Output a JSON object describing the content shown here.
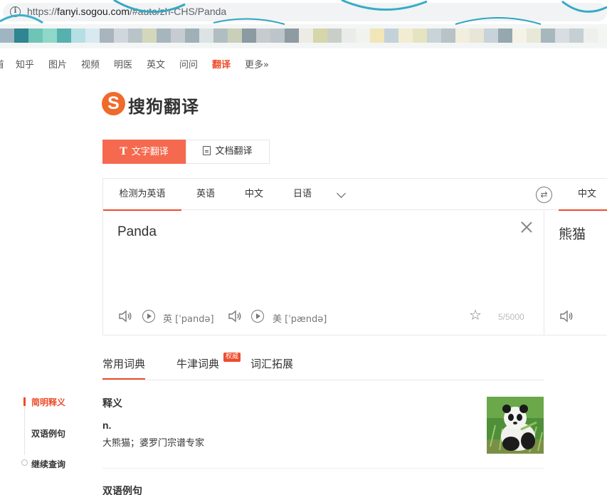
{
  "browser": {
    "url_scheme": "https://",
    "url_host": "fanyi.sogou.com",
    "url_path": "/#auto/zh-CHS/Panda"
  },
  "topnav": {
    "items": [
      {
        "label": "首",
        "active": false
      },
      {
        "label": "知乎",
        "active": false
      },
      {
        "label": "图片",
        "active": false
      },
      {
        "label": "视频",
        "active": false
      },
      {
        "label": "明医",
        "active": false
      },
      {
        "label": "英文",
        "active": false
      },
      {
        "label": "问问",
        "active": false
      },
      {
        "label": "翻译",
        "active": true
      },
      {
        "label": "更多»",
        "active": false
      }
    ]
  },
  "logo": {
    "text": "搜狗翻译",
    "mark": "S"
  },
  "modes": {
    "text_label": "文字翻译",
    "text_icon": "T",
    "doc_label": "文档翻译"
  },
  "translator": {
    "source_langs": [
      "检测为英语",
      "英语",
      "中文",
      "日语"
    ],
    "target_lang": "中文",
    "source_text": "Panda",
    "target_text": "熊猫",
    "uk_label": "英 [ˈpandə]",
    "us_label": "美 [ˈpændə]",
    "counter": "5/5000"
  },
  "dict": {
    "tabs": [
      "常用词典",
      "牛津词典",
      "词汇拓展"
    ],
    "badge": "权威",
    "side_nav": [
      "简明释义",
      "双语例句",
      "继续查询"
    ],
    "section_title": "释义",
    "pos": "n.",
    "definition": "大熊猫；婆罗门宗谱专家",
    "next_section": "双语例句"
  },
  "colors": {
    "accent": "#ee4c2c",
    "mode_active": "#f56a4f",
    "logo": "#f06a2b"
  }
}
